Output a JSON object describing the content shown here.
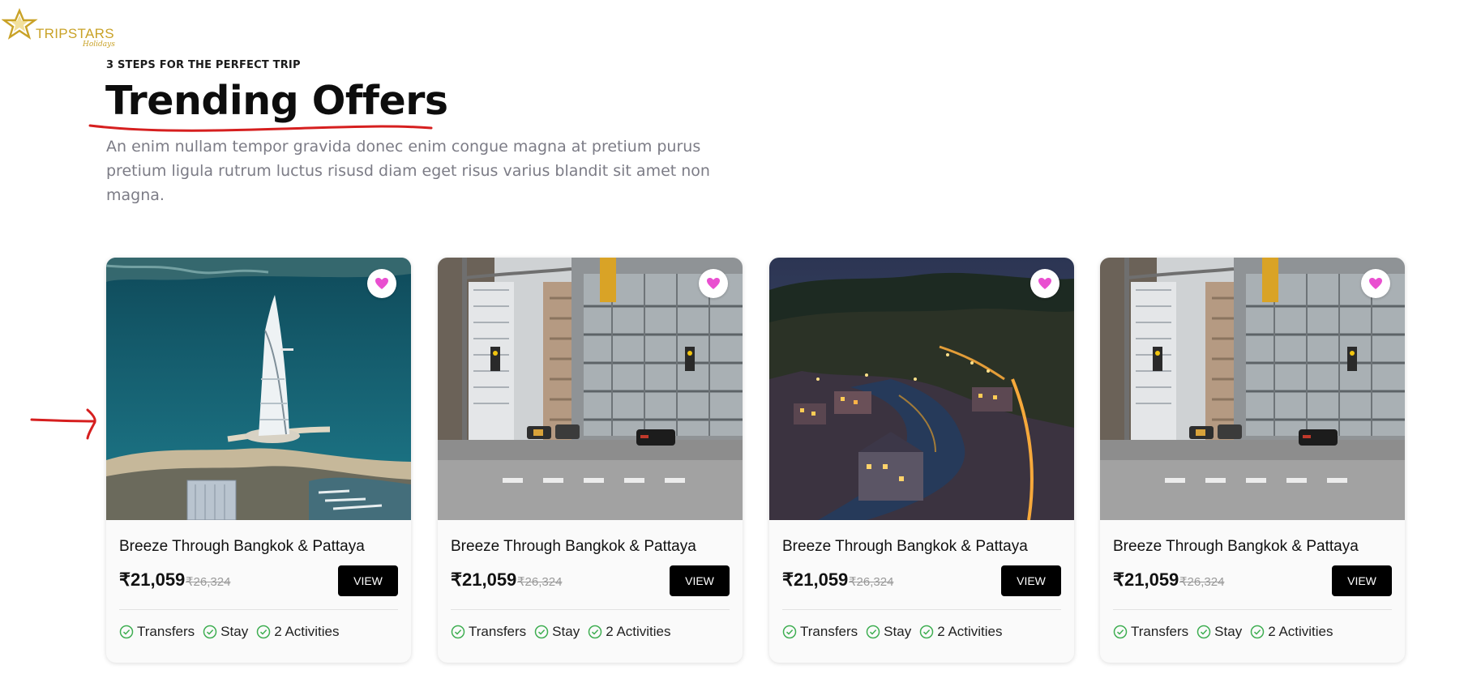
{
  "logo": {
    "brand": "TRIPSTARS",
    "tagline": "Holidays"
  },
  "section": {
    "eyebrow": "3 STEPS FOR THE PERFECT TRIP",
    "title": "Trending Offers",
    "description": "An enim nullam tempor gravida donec enim congue magna at pretium purus pretium ligula rutrum luctus risusd diam eget risus varius blandit sit amet non magna."
  },
  "colors": {
    "accent_gold": "#c9a227",
    "heart": "#e94fd0",
    "check": "#3fae52",
    "annotation": "#d61f1f"
  },
  "cards": [
    {
      "image": "dubai-burj-al-arab-photo",
      "title": "Breeze Through Bangkok & Pattaya",
      "price": "₹21,059",
      "old_price": "₹26,324",
      "cta": "VIEW",
      "features": [
        "Transfers",
        "Stay",
        "2 Activities"
      ]
    },
    {
      "image": "city-street-intersection-photo",
      "title": "Breeze Through Bangkok & Pattaya",
      "price": "₹21,059",
      "old_price": "₹26,324",
      "cta": "VIEW",
      "features": [
        "Transfers",
        "Stay",
        "2 Activities"
      ]
    },
    {
      "image": "night-river-town-photo",
      "title": "Breeze Through Bangkok & Pattaya",
      "price": "₹21,059",
      "old_price": "₹26,324",
      "cta": "VIEW",
      "features": [
        "Transfers",
        "Stay",
        "2 Activities"
      ]
    },
    {
      "image": "city-street-intersection-photo",
      "title": "Breeze Through Bangkok & Pattaya",
      "price": "₹21,059",
      "old_price": "₹26,324",
      "cta": "VIEW",
      "features": [
        "Transfers",
        "Stay",
        "2 Activities"
      ]
    }
  ]
}
